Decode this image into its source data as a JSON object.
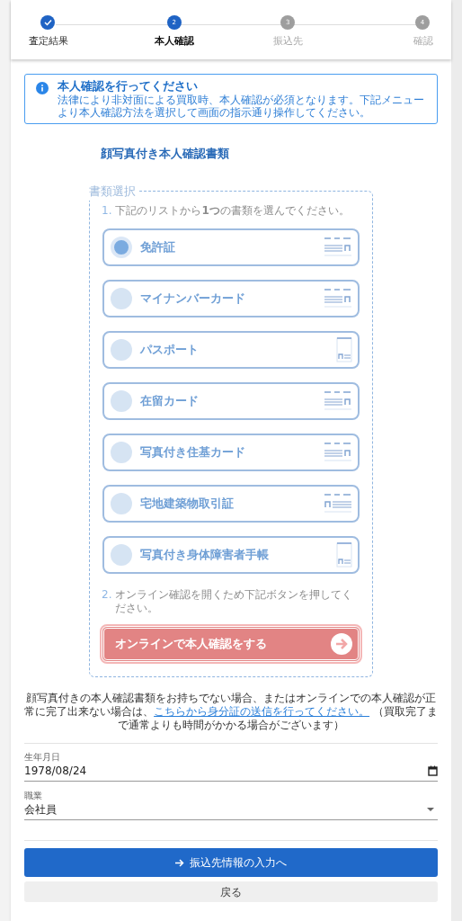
{
  "stepper": [
    {
      "label": "査定結果",
      "completed": true,
      "selected": false
    },
    {
      "number": "2",
      "label": "本人確認",
      "completed": false,
      "selected": true
    },
    {
      "number": "3",
      "label": "振込先",
      "completed": false,
      "selected": false
    },
    {
      "number": "4",
      "label": "確認",
      "completed": false,
      "selected": false
    }
  ],
  "alert": {
    "title": "本人確認を行ってください",
    "body": "法律により非対面による買取時、本人確認が必須となります。下記メニューより本人確認方法を選択して画面の指示通り操作してください。"
  },
  "section_title": "顔写真付き本人確認書類",
  "document_selection": {
    "legend": "書類選択",
    "disabled": true,
    "step_1": {
      "number": "1.",
      "text": "下記のリストから**1つ**の書類を選んでください。"
    },
    "options": [
      {
        "label": "免許証",
        "kind": "card",
        "selected": true
      },
      {
        "label": "マイナンバーカード",
        "kind": "card",
        "selected": false
      },
      {
        "label": "パスポート",
        "kind": "booklet",
        "selected": false
      },
      {
        "label": "在留カード",
        "kind": "card",
        "selected": false
      },
      {
        "label": "写真付き住基カード",
        "kind": "card",
        "selected": false
      },
      {
        "label": "宅地建築物取引証",
        "kind": "card-left",
        "selected": false
      },
      {
        "label": "写真付き身体障害者手帳",
        "kind": "booklet",
        "selected": false
      }
    ],
    "step_2": {
      "number": "2.",
      "text": "オンライン確認を開くため下記ボタンを押してください。"
    },
    "online_button": "オンラインで本人確認をする"
  },
  "note": {
    "text": "顔写真付きの本人確認書類をお持ちでない場合、またはオンラインでの本人確認が正常に完了出来ない場合は、",
    "link": "こちらから身分証の送信を行ってください。",
    "suffix": "（買取完了まで通常よりも時間がかかる場合がございます）"
  },
  "birth_date": {
    "label": "生年月日",
    "value": "1978/08/24"
  },
  "occupation": {
    "label": "職業",
    "value": "会社員"
  },
  "next_button": "振込先情報の入力へ",
  "back_button": "戻る"
}
